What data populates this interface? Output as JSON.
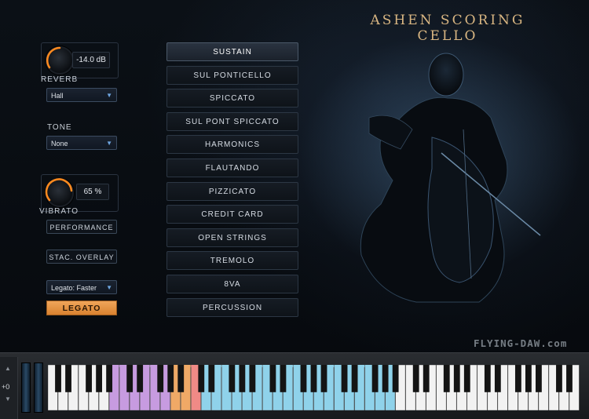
{
  "title": "ASHEN SCORING CELLO",
  "reverb": {
    "label": "REVERB",
    "value": "-14.0 dB",
    "type": "Hall",
    "knob_fraction": 0.35
  },
  "tone": {
    "label": "TONE",
    "value": "None"
  },
  "vibrato": {
    "label": "VIBRATO",
    "value": "65 %",
    "knob_fraction": 0.65
  },
  "buttons": {
    "performance": "PERFORMANCE",
    "stac_overlay": "STAC. OVERLAY",
    "legato_mode": "Legato: Faster",
    "legato": "LEGATO"
  },
  "articulations": [
    "SUSTAIN",
    "SUL PONTICELLO",
    "SPICCATO",
    "SUL PONT SPICCATO",
    "HARMONICS",
    "FLAUTANDO",
    "PIZZICATO",
    "CREDIT CARD",
    "OPEN STRINGS",
    "TREMOLO",
    "8VA",
    "PERCUSSION"
  ],
  "active_articulation": "SUSTAIN",
  "watermark": "FLYING-DAW.com",
  "keyboard": {
    "transpose": "+0",
    "white_keys": 52,
    "zones": [
      {
        "from": 6,
        "to": 11,
        "color": "#c79be0"
      },
      {
        "from": 12,
        "to": 13,
        "color": "#f0a966"
      },
      {
        "from": 14,
        "to": 14,
        "color": "#f08a86"
      },
      {
        "from": 15,
        "to": 33,
        "color": "#8fd2ea"
      }
    ],
    "pressed_key": 6
  },
  "colors": {
    "accent_orange": "#e89440",
    "knob_glow": "#ff8a1f",
    "label": "#c8ced6",
    "zone_blue": "#8fd2ea"
  }
}
